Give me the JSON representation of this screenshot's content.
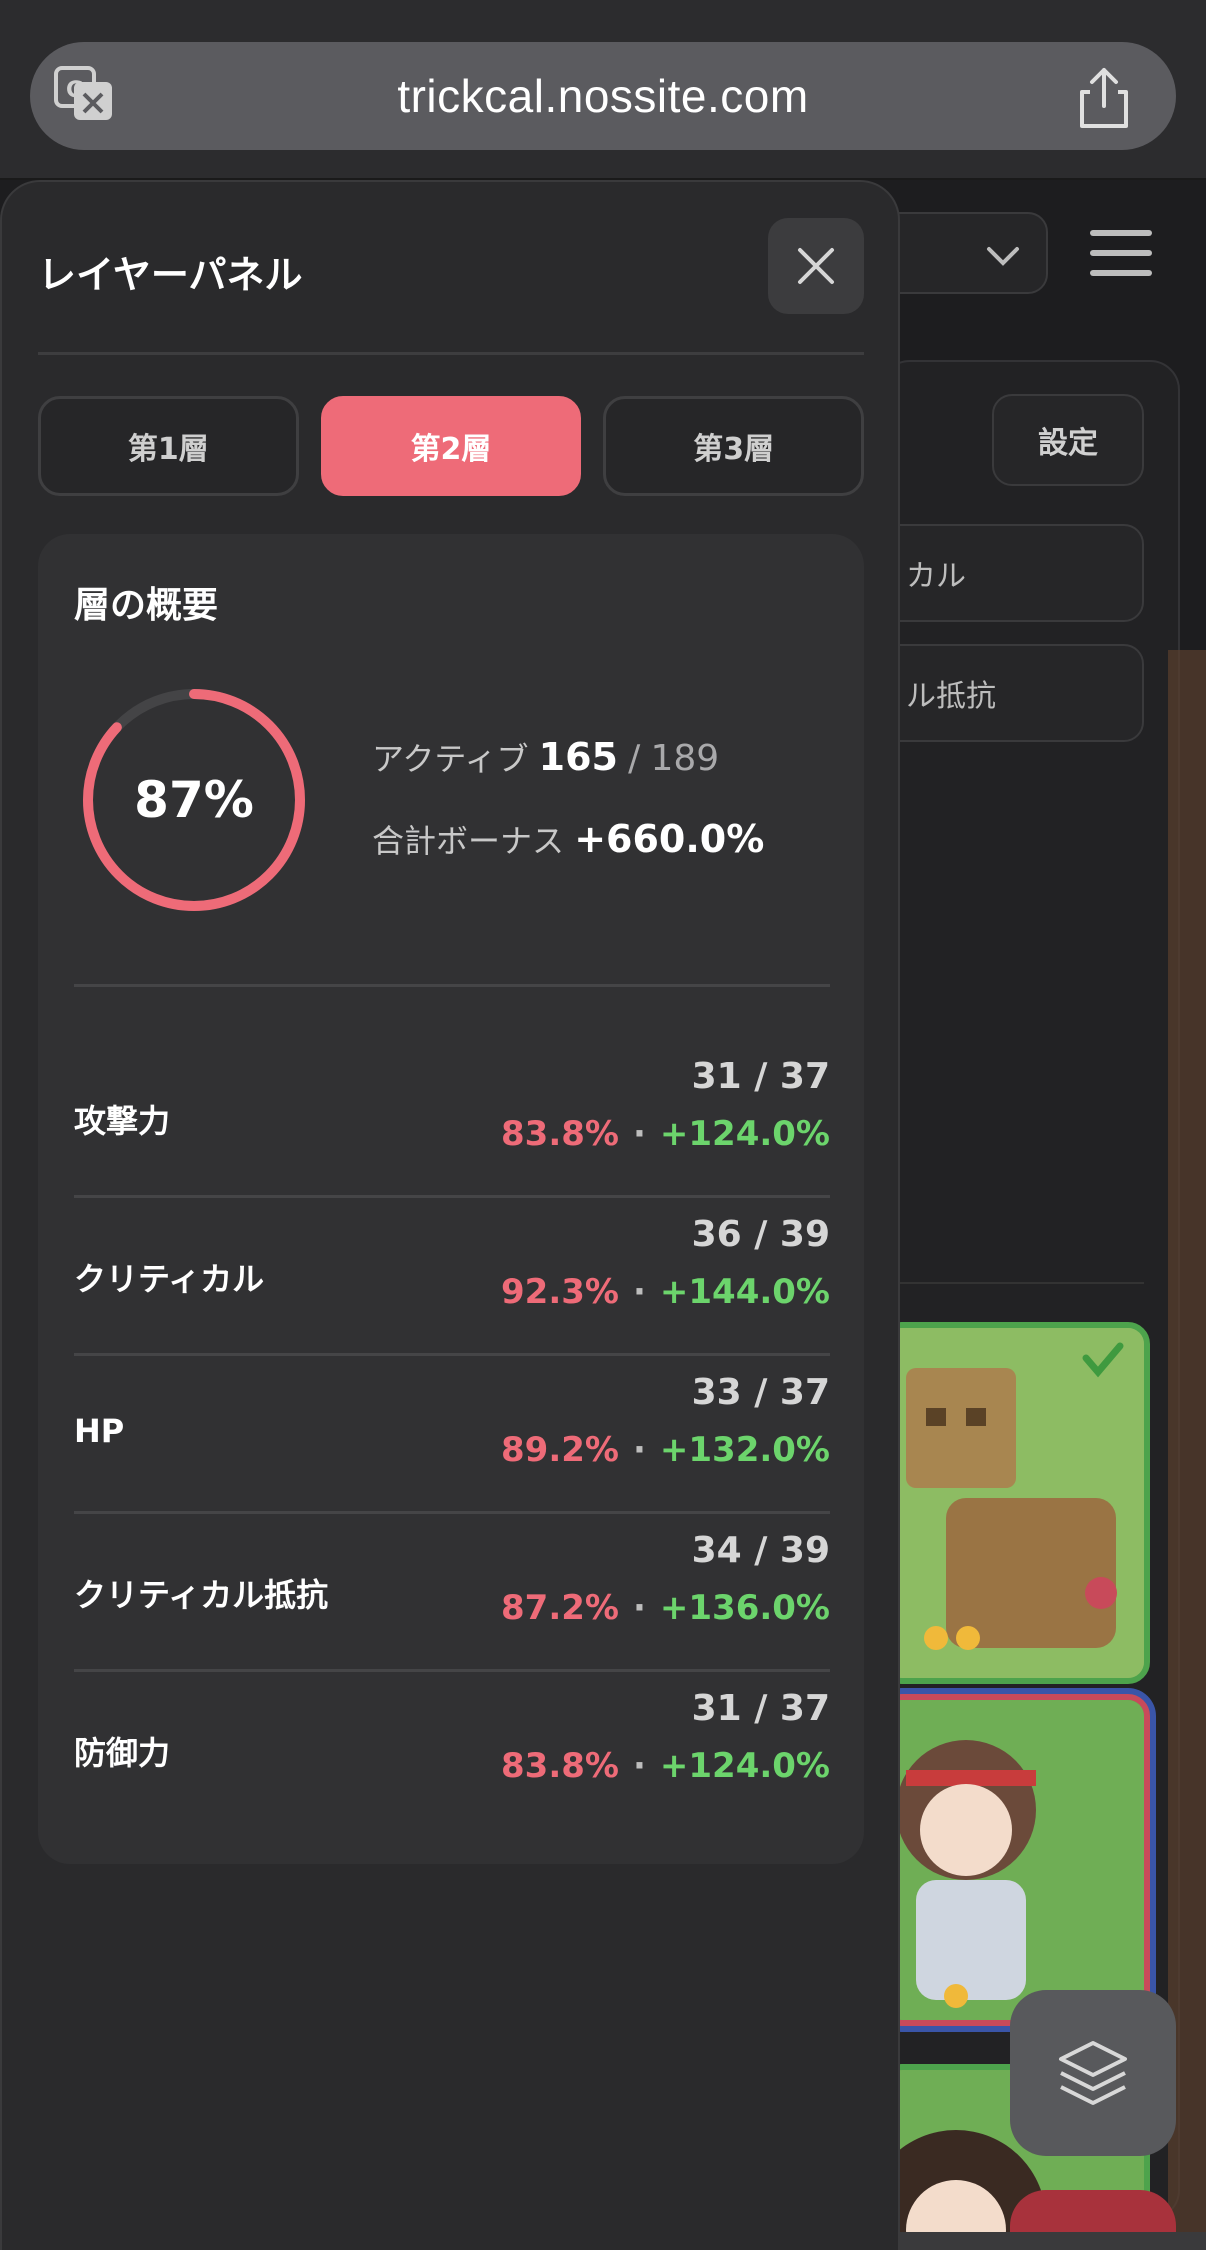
{
  "browser": {
    "url": "trickcal.nossite.com"
  },
  "background": {
    "settings_label": "設定",
    "row1_label": "カル",
    "row2_label": "ル抵抗"
  },
  "panel": {
    "title": "レイヤーパネル",
    "tabs": [
      {
        "label": "第1層",
        "active": false
      },
      {
        "label": "第2層",
        "active": true
      },
      {
        "label": "第3層",
        "active": false
      }
    ],
    "summary": {
      "title": "層の概要",
      "ring_percent": 0.87,
      "ring_label": "87%",
      "active_label": "アクティブ",
      "active_count": "165",
      "active_sep": "/",
      "active_total": "189",
      "bonus_label": "合計ボーナス",
      "bonus_value": "+660.0%"
    },
    "layers": [
      {
        "name": "攻撃力",
        "count": "31 / 37",
        "rate": "83.8%",
        "sep": "·",
        "bonus": "+124.0%"
      },
      {
        "name": "クリティカル",
        "count": "36 / 39",
        "rate": "92.3%",
        "sep": "·",
        "bonus": "+144.0%"
      },
      {
        "name": "HP",
        "count": "33 / 37",
        "rate": "89.2%",
        "sep": "·",
        "bonus": "+132.0%"
      },
      {
        "name": "クリティカル抵抗",
        "count": "34 / 39",
        "rate": "87.2%",
        "sep": "·",
        "bonus": "+136.0%"
      },
      {
        "name": "防御力",
        "count": "31 / 37",
        "rate": "83.8%",
        "sep": "·",
        "bonus": "+124.0%"
      }
    ]
  },
  "colors": {
    "accent": "#ee6b78",
    "positive": "#6cd46c",
    "chart_button": "#a8323c"
  }
}
